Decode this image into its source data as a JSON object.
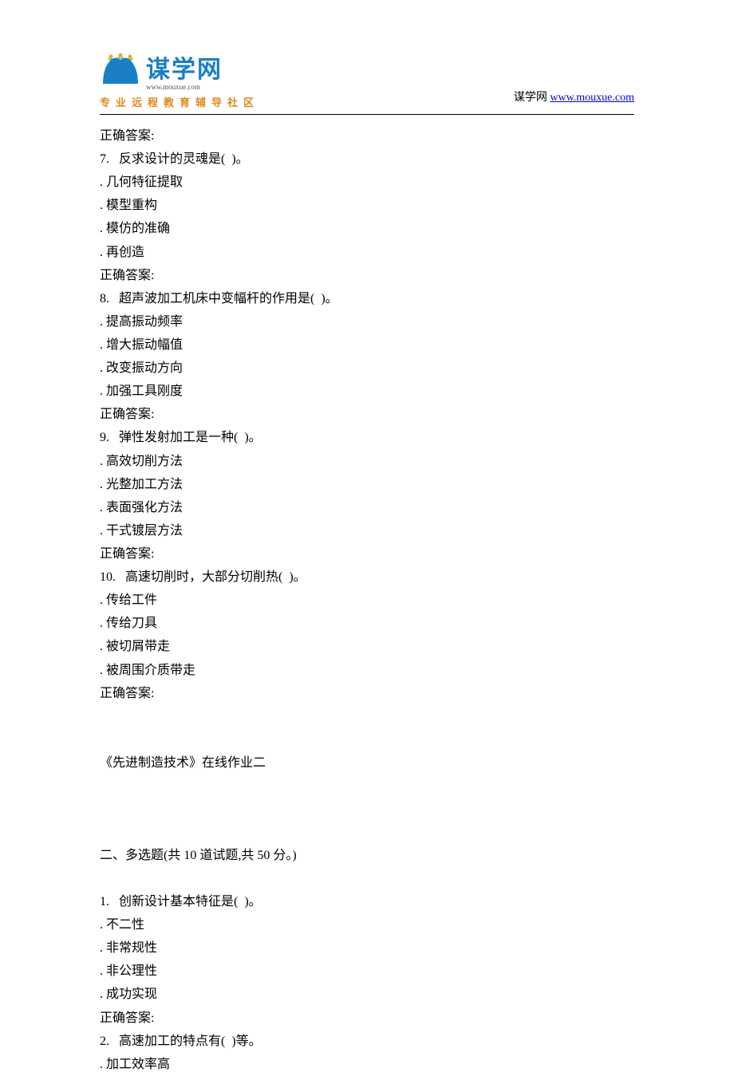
{
  "header": {
    "logo_chinese": "谋学网",
    "logo_url": "www.mouxue.com",
    "logo_subtitle": "专业远程教育辅导社区",
    "right_text": "谋学网 ",
    "right_link": "www.mouxue.com"
  },
  "content": {
    "lines": [
      "正确答案:",
      "7.   反求设计的灵魂是(  )。",
      ". 几何特征提取",
      ". 模型重构",
      ". 模仿的准确",
      ". 再创造",
      "正确答案:",
      "8.   超声波加工机床中变幅杆的作用是(  )。",
      ". 提高振动频率",
      ". 增大振动幅值",
      ". 改变振动方向",
      ". 加强工具刚度",
      "正确答案:",
      "9.   弹性发射加工是一种(  )。",
      ". 高效切削方法",
      ". 光整加工方法",
      ". 表面强化方法",
      ". 干式镀层方法",
      "正确答案:",
      "10.   高速切削时，大部分切削热(  )。",
      ". 传给工件",
      ". 传给刀具",
      ". 被切屑带走",
      ". 被周围介质带走",
      "正确答案:"
    ],
    "section2_title": "《先进制造技术》在线作业二",
    "section2_heading": "二、多选题(共 10 道试题,共 50 分。)",
    "section2_lines": [
      "1.   创新设计基本特征是(  )。",
      ". 不二性",
      ". 非常规性",
      ". 非公理性",
      ". 成功实现",
      "正确答案:",
      "2.   高速加工的特点有(  )等。",
      ". 加工效率高"
    ]
  }
}
